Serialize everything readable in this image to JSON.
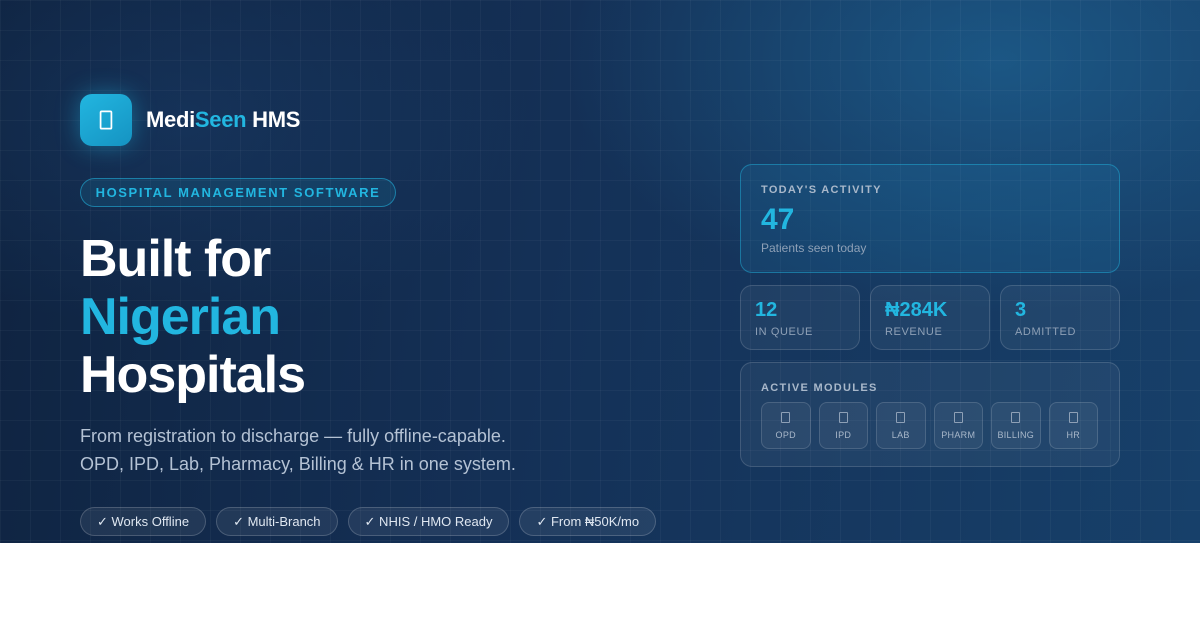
{
  "brand": {
    "name_part1": "Medi",
    "name_part2": "Seen",
    "name_part3": " HMS",
    "logo_icon": "hospital-icon"
  },
  "tagline": "HOSPITAL MANAGEMENT SOFTWARE",
  "headline": {
    "line1": "Built for",
    "line2": "Nigerian",
    "line3": "Hospitals"
  },
  "subtitle": {
    "line1": "From registration to discharge — fully offline-capable.",
    "line2": "OPD, IPD, Lab, Pharmacy, Billing & HR in one system."
  },
  "features": [
    "✓ Works Offline",
    "✓ Multi-Branch",
    "✓ NHIS / HMO Ready",
    "✓ From ₦50K/mo"
  ],
  "activity": {
    "label": "TODAY'S ACTIVITY",
    "value": "47",
    "sub": "Patients seen today"
  },
  "stats": [
    {
      "value": "12",
      "label": "IN QUEUE"
    },
    {
      "value": "₦284K",
      "label": "REVENUE"
    },
    {
      "value": "3",
      "label": "ADMITTED"
    }
  ],
  "modules": {
    "label": "ACTIVE MODULES",
    "items": [
      {
        "label": "OPD",
        "icon": "module-icon"
      },
      {
        "label": "IPD",
        "icon": "module-icon"
      },
      {
        "label": "LAB",
        "icon": "module-icon"
      },
      {
        "label": "PHARM",
        "icon": "module-icon"
      },
      {
        "label": "BILLING",
        "icon": "module-icon"
      },
      {
        "label": "HR",
        "icon": "module-icon"
      }
    ]
  },
  "colors": {
    "accent": "#22b6e0",
    "background_dark": "#0f2340",
    "background_light": "#17406a",
    "text_muted": "#b4c2d4"
  }
}
